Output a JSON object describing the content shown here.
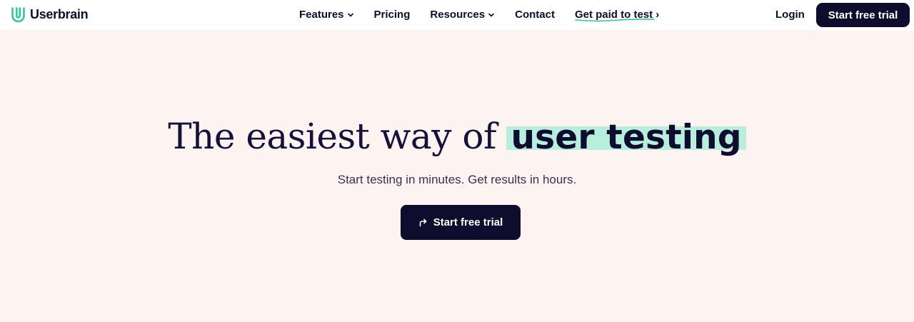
{
  "brand": {
    "name": "Userbrain",
    "logo_icon": "userbrain-u-logo-icon",
    "accent_color": "#2ec7a2",
    "dark_color": "#0f0d2e",
    "highlight_color": "#b8eedd"
  },
  "nav": {
    "items": [
      {
        "label": "Features",
        "has_dropdown": true
      },
      {
        "label": "Pricing",
        "has_dropdown": false
      },
      {
        "label": "Resources",
        "has_dropdown": true
      },
      {
        "label": "Contact",
        "has_dropdown": false
      }
    ],
    "paid_link": "Get paid to test ›",
    "login": "Login",
    "cta": "Start free trial"
  },
  "hero": {
    "title_plain": "The easiest way of",
    "title_highlight": "user testing",
    "subtitle": "Start testing in minutes. Get results in hours.",
    "cta_label": "Start free trial",
    "cta_icon": "arrow-turn-right-icon"
  }
}
